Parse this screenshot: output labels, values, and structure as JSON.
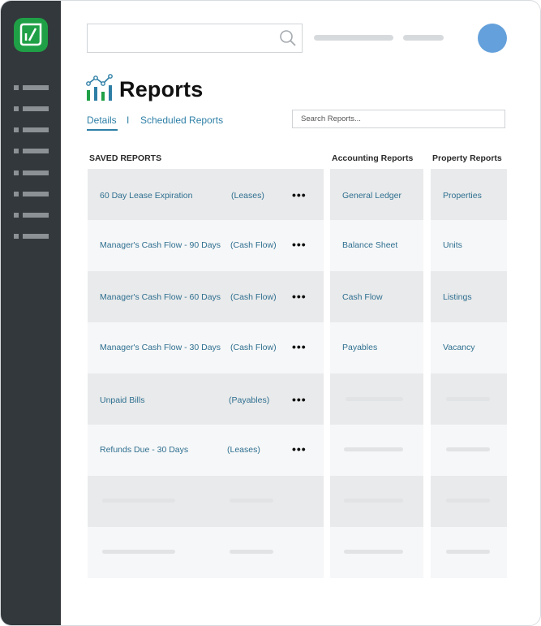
{
  "header": {
    "search_placeholder": "",
    "avatar_color": "#64a0db"
  },
  "page": {
    "title": "Reports",
    "tabs": [
      {
        "label": "Details",
        "active": true
      },
      {
        "label": "Scheduled Reports",
        "active": false
      }
    ],
    "tab_separator": "I",
    "search_placeholder": "Search Reports..."
  },
  "columns": {
    "saved": "SAVED REPORTS",
    "accounting": "Accounting Reports",
    "property": "Property Reports"
  },
  "saved_reports": [
    {
      "name": "60 Day Lease Expiration",
      "category": "(Leases)"
    },
    {
      "name": "Manager's Cash Flow - 90 Days",
      "category": "(Cash Flow)"
    },
    {
      "name": "Manager's Cash Flow - 60 Days",
      "category": "(Cash Flow)"
    },
    {
      "name": "Manager's Cash Flow - 30 Days",
      "category": "(Cash Flow)"
    },
    {
      "name": "Unpaid Bills",
      "category": "(Payables)"
    },
    {
      "name": "Refunds Due - 30 Days",
      "category": "(Leases)"
    }
  ],
  "more_label": "•••",
  "accounting_reports": [
    "General Ledger",
    "Balance Sheet",
    "Cash Flow",
    "Payables"
  ],
  "property_reports": [
    "Properties",
    "Units",
    "Listings",
    "Vacancy"
  ],
  "colors": {
    "sidebar": "#33383c",
    "brand_green": "#1fa046",
    "link": "#2e6f90",
    "accent": "#2e7fa6"
  }
}
